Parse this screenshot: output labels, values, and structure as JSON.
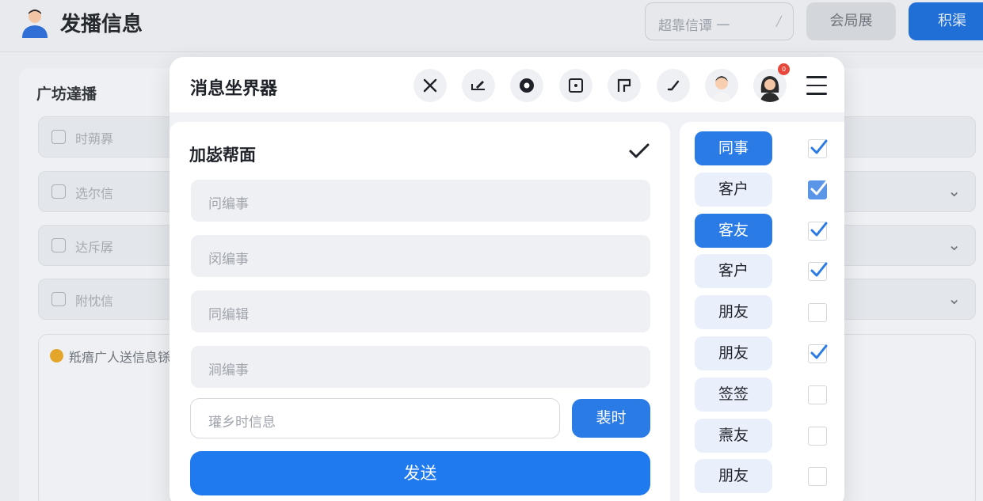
{
  "app": {
    "title": "发播信息",
    "search_placeholder": "超靠信谭 一",
    "btn_gray": "会局展",
    "btn_blue": "积渠"
  },
  "background": {
    "section_title": "广坊達播",
    "rows": [
      {
        "label": "时蒴奡",
        "has_chevron": false
      },
      {
        "label": "选尔信",
        "has_chevron": true
      },
      {
        "label": "达斥孱",
        "has_chevron": true
      },
      {
        "label": "附忱信",
        "has_chevron": true
      }
    ],
    "note_text": "羝瘖广人送信息铩"
  },
  "modal": {
    "title": "消息坐界器",
    "badge": "0",
    "card_title": "加毖帮面",
    "fields": [
      "问编事",
      "闵编事",
      "同编辑",
      "涧编事"
    ],
    "time_placeholder": "瓘乡时信息",
    "time_button": "裴时",
    "send_button": "发送",
    "recipients": [
      {
        "label": "同事",
        "active": true,
        "checked": true,
        "filled": false
      },
      {
        "label": "客户",
        "active": false,
        "checked": true,
        "filled": true
      },
      {
        "label": "客友",
        "active": true,
        "checked": true,
        "filled": false
      },
      {
        "label": "客户",
        "active": false,
        "checked": true,
        "filled": false
      },
      {
        "label": "朋友",
        "active": false,
        "checked": false,
        "filled": false
      },
      {
        "label": "朋友",
        "active": false,
        "checked": true,
        "filled": false
      },
      {
        "label": "签签",
        "active": false,
        "checked": false,
        "filled": false
      },
      {
        "label": "燾友",
        "active": false,
        "checked": false,
        "filled": false
      },
      {
        "label": "朋友",
        "active": false,
        "checked": false,
        "filled": false
      }
    ]
  },
  "colors": {
    "accent": "#2b7be7",
    "send": "#1f7af0",
    "check": "#2b7be7"
  }
}
